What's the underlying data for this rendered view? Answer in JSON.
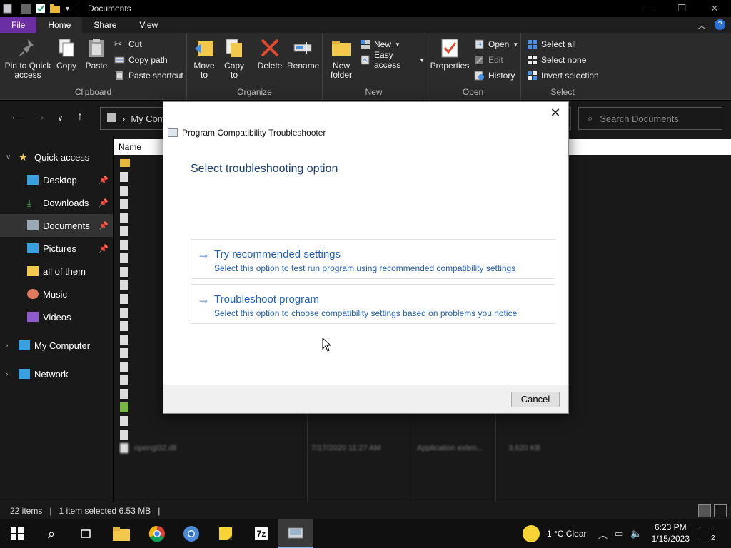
{
  "window": {
    "title": "Documents"
  },
  "ribbon_tabs": [
    "File",
    "Home",
    "Share",
    "View"
  ],
  "ribbon": {
    "clipboard": {
      "pin_label": "Pin to Quick access",
      "copy_label": "Copy",
      "paste_label": "Paste",
      "cut_label": "Cut",
      "copy_path_label": "Copy path",
      "paste_shortcut_label": "Paste shortcut",
      "group_label": "Clipboard"
    },
    "organize": {
      "move_to_label": "Move to",
      "copy_to_label": "Copy to",
      "delete_label": "Delete",
      "rename_label": "Rename",
      "group_label": "Organize"
    },
    "new": {
      "new_folder_label": "New folder",
      "new_item_label": "New",
      "easy_access_label": "Easy access",
      "group_label": "New"
    },
    "open": {
      "properties_label": "Properties",
      "open_label": "Open",
      "edit_label": "Edit",
      "history_label": "History",
      "group_label": "Open"
    },
    "select": {
      "select_all_label": "Select all",
      "select_none_label": "Select none",
      "invert_label": "Invert selection",
      "group_label": "Select"
    }
  },
  "address": {
    "path": "My Com",
    "search_placeholder": "Search Documents"
  },
  "nav": {
    "quick_access": "Quick access",
    "items": [
      {
        "label": "Desktop",
        "icon": "desktop-icon",
        "pinned": true
      },
      {
        "label": "Downloads",
        "icon": "download-icon",
        "pinned": true
      },
      {
        "label": "Documents",
        "icon": "documents-icon",
        "pinned": true
      },
      {
        "label": "Pictures",
        "icon": "pictures-icon",
        "pinned": true
      },
      {
        "label": "all of them",
        "icon": "folder-icon",
        "pinned": false
      },
      {
        "label": "Music",
        "icon": "music-icon",
        "pinned": false
      },
      {
        "label": "Videos",
        "icon": "videos-icon",
        "pinned": false
      }
    ],
    "my_computer": "My Computer",
    "network": "Network"
  },
  "files": {
    "column_name": "Name",
    "rows": [
      {
        "name": "opengl32.dll",
        "date": "7/17/2020 11:27 AM",
        "type": "Application exten...",
        "size": "3,620 KB"
      }
    ]
  },
  "status": {
    "items": "22 items",
    "selected": "1 item selected  6.53 MB"
  },
  "dialog": {
    "title": "Program Compatibility Troubleshooter",
    "heading": "Select troubleshooting option",
    "options": [
      {
        "title": "Try recommended settings",
        "desc": "Select this option to test run program using recommended compatibility settings"
      },
      {
        "title": "Troubleshoot program",
        "desc": "Select this option to choose compatibility settings based on problems you notice"
      }
    ],
    "cancel_label": "Cancel"
  },
  "taskbar": {
    "weather": "1 °C  Clear",
    "time": "6:23 PM",
    "date": "1/15/2023",
    "notifications": "2"
  },
  "colors": {
    "file_tab": "#6b2fa3",
    "link_blue": "#1f5fbf",
    "heading_blue": "#1a3f7a"
  }
}
